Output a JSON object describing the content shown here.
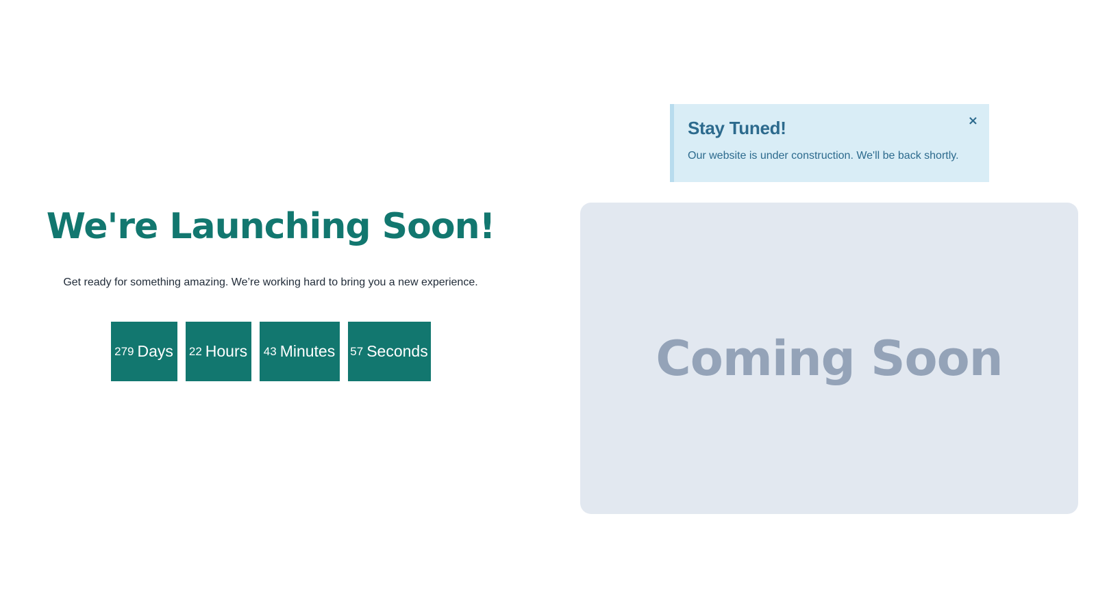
{
  "hero": {
    "title": "We're Launching Soon!",
    "subtitle": "Get ready for something amazing. We’re working hard to bring you a new experience."
  },
  "countdown": {
    "days": {
      "value": "279",
      "label": "Days"
    },
    "hours": {
      "value": "22",
      "label": "Hours"
    },
    "minutes": {
      "value": "43",
      "label": "Minutes"
    },
    "seconds": {
      "value": "57",
      "label": "Seconds"
    }
  },
  "alert": {
    "title": "Stay Tuned!",
    "message": "Our website is under construction. We'll be back shortly.",
    "close_glyph": "×",
    "close_icon": "close-icon"
  },
  "placeholder": {
    "text": "Coming Soon"
  },
  "colors": {
    "primary": "#12776f",
    "alert_bg": "#d9edf6",
    "alert_text": "#2c6a8d",
    "placeholder_bg": "#e2e8f0",
    "placeholder_text": "#94a3b8"
  }
}
